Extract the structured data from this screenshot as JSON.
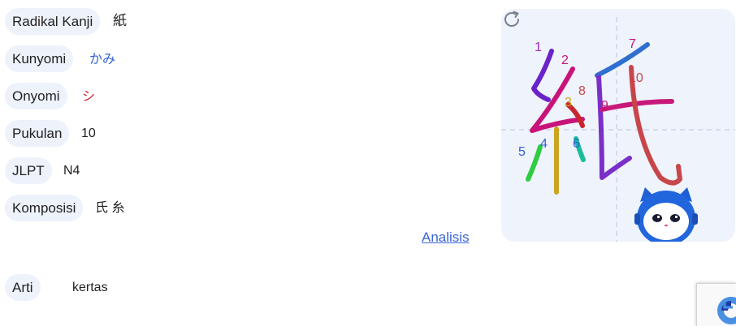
{
  "info": {
    "radical_label": "Radikal Kanji",
    "radical_value": "紙",
    "kunyomi_label": "Kunyomi",
    "kunyomi_value": "かみ",
    "onyomi_label": "Onyomi",
    "onyomi_value": "シ",
    "strokes_label": "Pukulan",
    "strokes_value": "10",
    "jlpt_label": "JLPT",
    "jlpt_value": "N4",
    "composition_label": "Komposisi",
    "composition_value": "氏 糸",
    "analysis_link": "Analisis",
    "meaning_label": "Arti",
    "meaning_value": "kertas"
  },
  "stroke_diagram": {
    "kanji": "紙",
    "stroke_numbers": [
      "1",
      "2",
      "3",
      "4",
      "5",
      "6",
      "7",
      "8",
      "9",
      "10"
    ],
    "colors": {
      "kunyomi": "#2f5fd6",
      "onyomi": "#c8262f",
      "card_bg": "#eef3fc",
      "guide": "#b9c4dc"
    },
    "icons": {
      "refresh": "refresh-icon",
      "mascot": "robot-cat-mascot",
      "captcha": "recaptcha-icon"
    }
  }
}
